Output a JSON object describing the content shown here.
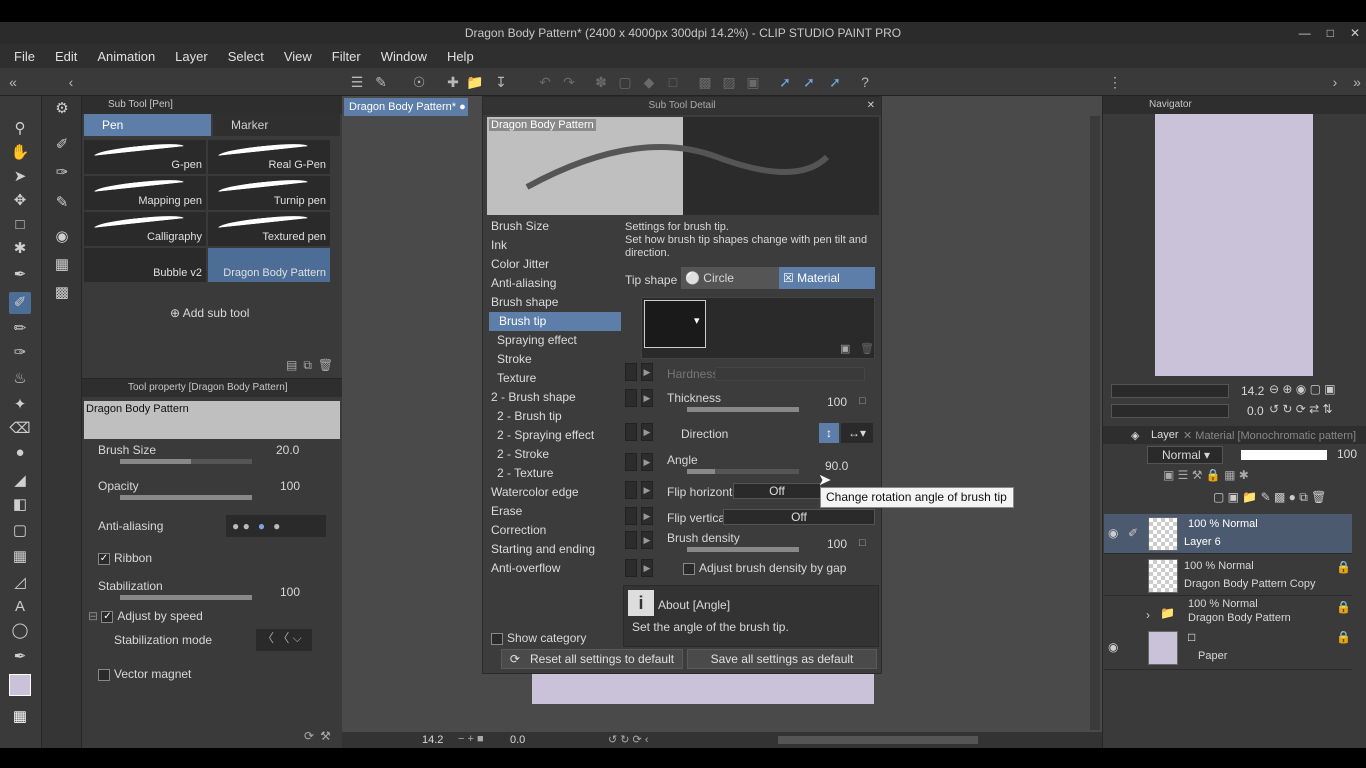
{
  "window": {
    "title": "Dragon Body Pattern* (2400 x 4000px 300dpi 14.2%)  - CLIP STUDIO PAINT PRO"
  },
  "menu": [
    "File",
    "Edit",
    "Animation",
    "Layer",
    "Select",
    "View",
    "Filter",
    "Window",
    "Help"
  ],
  "subtool": {
    "header": "Sub Tool [Pen]",
    "tabs": [
      "Pen",
      "Marker"
    ],
    "brushes": [
      "G-pen",
      "Real G-Pen",
      "Mapping pen",
      "Turnip pen",
      "Calligraphy",
      "Textured pen",
      "Bubble v2",
      "Dragon Body Pattern"
    ],
    "add_label": "Add sub tool"
  },
  "toolprop": {
    "header": "Tool property [Dragon Body Pattern]",
    "preview_label": "Dragon Body Pattern",
    "brush_size_label": "Brush Size",
    "brush_size_value": "20.0",
    "opacity_label": "Opacity",
    "opacity_value": "100",
    "anti_label": "Anti-aliasing",
    "ribbon_label": "Ribbon",
    "stab_label": "Stabilization",
    "stab_value": "100",
    "adjust_label": "Adjust by speed",
    "stab_mode_label": "Stabilization mode",
    "vector_label": "Vector magnet"
  },
  "canvas": {
    "tab_label": "Dragon Body Pattern*"
  },
  "dialog": {
    "title": "Sub Tool Detail",
    "preview_label": "Dragon Body Pattern",
    "categories": [
      "Brush Size",
      "Ink",
      "Color Jitter",
      "Anti-aliasing",
      "Brush shape",
      "Brush tip",
      "Spraying effect",
      "Stroke",
      "Texture",
      "2 - Brush shape",
      "2 - Brush tip",
      "2 - Spraying effect",
      "2 - Stroke",
      "2 - Texture",
      "Watercolor edge",
      "Erase",
      "Correction",
      "Starting and ending",
      "Anti-overflow"
    ],
    "desc_title": "Settings for brush tip.",
    "desc_body": "Set how brush tip shapes change with pen tilt and direction.",
    "tip_shape_label": "Tip shape",
    "circle_label": "Circle",
    "material_label": "Material",
    "hardness_label": "Hardness",
    "thickness_label": "Thickness",
    "thickness_value": "100",
    "direction_label": "Direction",
    "angle_label": "Angle",
    "angle_value": "90.0",
    "fliph_label": "Flip horizontal",
    "fliph_value": "Off",
    "flipv_label": "Flip vertical",
    "flipv_value": "Off",
    "density_label": "Brush density",
    "density_value": "100",
    "adjust_gap_label": "Adjust brush density by gap",
    "about_title": "About [Angle]",
    "about_body": "Set the angle of the brush tip.",
    "show_category_label": "Show category",
    "reset_label": "Reset all settings to default",
    "save_label": "Save all settings as default",
    "tooltip": "Change rotation angle of brush tip"
  },
  "navigator": {
    "title": "Navigator",
    "zoom": "14.2",
    "angle": "0.0"
  },
  "layers": {
    "tab_label": "Layer",
    "material_tab": "Material [Monochromatic pattern]",
    "blend_mode": "Normal",
    "opacity": "100",
    "items": [
      {
        "mode": "100 % Normal",
        "name": "Layer 6"
      },
      {
        "mode": "100 % Normal",
        "name": "Dragon Body Pattern Copy"
      },
      {
        "mode": "100 % Normal",
        "name": "Dragon Body Pattern"
      },
      {
        "mode": "",
        "name": "Paper"
      }
    ]
  },
  "status": {
    "zoom": "14.2",
    "angle": "0.0"
  },
  "colors": {
    "accent": "#5d7ea8",
    "paper": "#c9c2d9"
  }
}
